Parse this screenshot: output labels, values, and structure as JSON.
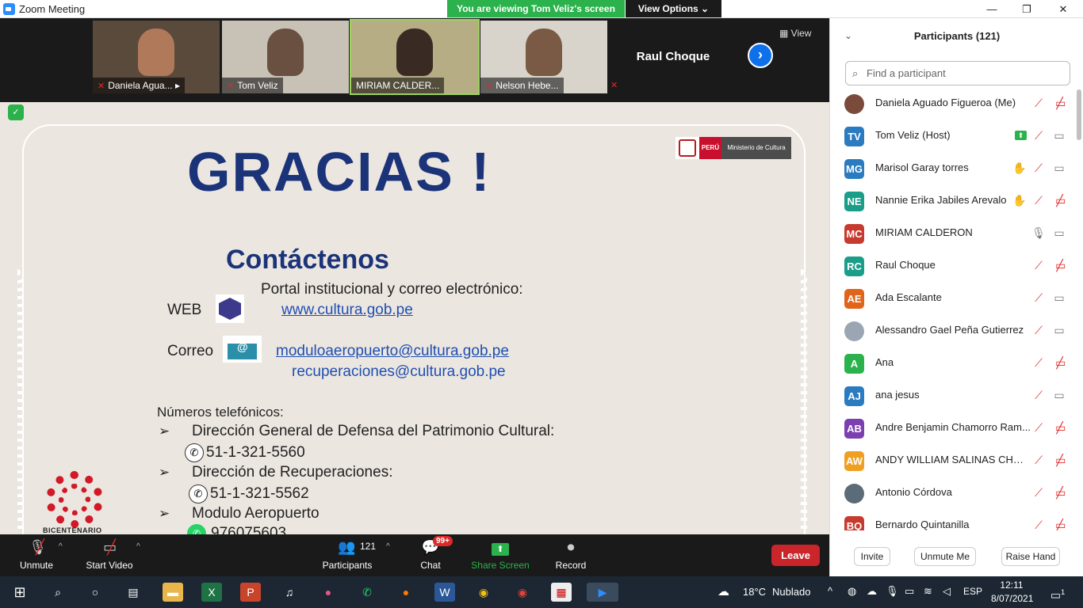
{
  "window": {
    "title": "Zoom Meeting",
    "viewing_banner": "You are viewing Tom Veliz's screen",
    "view_options": "View Options ⌄",
    "minimize": "—",
    "maximize": "❐",
    "close": "✕"
  },
  "gallery": {
    "thumbnails": [
      {
        "name": "Daniela Agua... ▸"
      },
      {
        "name": "Tom Veliz"
      },
      {
        "name": "MIRIAM CALDER..."
      },
      {
        "name": "Nelson Hebe..."
      },
      {
        "name": ""
      }
    ],
    "raul_tile": "Raul Choque",
    "next_arrow": "›",
    "view_label": "▦  View"
  },
  "slide": {
    "peru": "PERÚ",
    "ministerio": "Ministerio de Cultura",
    "gracias": "GRACIAS !",
    "contactenos": "Contáctenos",
    "portal": "Portal institucional y correo electrónico:",
    "web_label": "WEB",
    "web_url": "www.cultura.gob.pe",
    "correo_label": "Correo",
    "email1": "moduloaeropuerto@cultura.gob.pe",
    "email2": "recuperaciones@cultura.gob.pe",
    "numeros": "Números telefónicos:",
    "bullet_glyph": "➢",
    "dir1": "Dirección General de Defensa del Patrimonio Cultural:",
    "phone1": "51-1-321-5560",
    "dir2": "Dirección de Recuperaciones:",
    "phone2": "51-1-321-5562",
    "dir3": "Modulo Aeropuerto",
    "phone3": "976075603",
    "bicentenario": "BICENTENARIO"
  },
  "toolbar": {
    "unmute": "Unmute",
    "start_video": "Start Video",
    "participants": "Participants",
    "participants_count": "121",
    "chat": "Chat",
    "chat_badge": "99+",
    "share_screen": "Share Screen",
    "record": "Record",
    "leave": "Leave"
  },
  "panel": {
    "title": "Participants (121)",
    "collapse": "⌄",
    "search_placeholder": "Find a participant",
    "participants": [
      {
        "name": "Daniela Aguado Figueroa (Me)",
        "initials": "",
        "color": "#7a4a3a",
        "photo": true,
        "mic": "muted",
        "cam": "off",
        "hand": false,
        "sharing": false
      },
      {
        "name": "Tom Veliz (Host)",
        "initials": "TV",
        "color": "#2a7bbf",
        "photo": false,
        "mic": "muted",
        "cam": "on",
        "hand": false,
        "sharing": true
      },
      {
        "name": "Marisol Garay torres",
        "initials": "MG",
        "color": "#2a7bbf",
        "photo": false,
        "mic": "muted",
        "cam": "on",
        "hand": true,
        "sharing": false
      },
      {
        "name": "Nannie Erika Jabiles Arevalo",
        "initials": "NE",
        "color": "#1a9e8a",
        "photo": false,
        "mic": "muted",
        "cam": "off",
        "hand": true,
        "sharing": false
      },
      {
        "name": "MIRIAM CALDERON",
        "initials": "MC",
        "color": "#c73a2e",
        "photo": false,
        "mic": "on",
        "cam": "on",
        "hand": false,
        "sharing": false
      },
      {
        "name": "Raul Choque",
        "initials": "RC",
        "color": "#1a9e8a",
        "photo": false,
        "mic": "muted",
        "cam": "off",
        "hand": false,
        "sharing": false
      },
      {
        "name": "Ada Escalante",
        "initials": "AE",
        "color": "#e0641a",
        "photo": false,
        "mic": "muted",
        "cam": "on",
        "hand": false,
        "sharing": false
      },
      {
        "name": "Alessandro Gael Peña Gutierrez",
        "initials": "",
        "color": "#9aa7b3",
        "photo": true,
        "mic": "muted",
        "cam": "on",
        "hand": false,
        "sharing": false
      },
      {
        "name": "Ana",
        "initials": "A",
        "color": "#2bb24c",
        "photo": false,
        "mic": "muted",
        "cam": "off",
        "hand": false,
        "sharing": false
      },
      {
        "name": "ana jesus",
        "initials": "AJ",
        "color": "#2a7bbf",
        "photo": false,
        "mic": "muted",
        "cam": "on",
        "hand": false,
        "sharing": false
      },
      {
        "name": "Andre Benjamin Chamorro Ram...",
        "initials": "AB",
        "color": "#7b3fb0",
        "photo": false,
        "mic": "muted",
        "cam": "off",
        "hand": false,
        "sharing": false
      },
      {
        "name": "ANDY WILLIAM SALINAS CHUM...",
        "initials": "AW",
        "color": "#f0a020",
        "photo": false,
        "mic": "muted",
        "cam": "off",
        "hand": false,
        "sharing": false
      },
      {
        "name": "Antonio Córdova",
        "initials": "",
        "color": "#5b6b78",
        "photo": true,
        "mic": "muted",
        "cam": "off",
        "hand": false,
        "sharing": false
      },
      {
        "name": "Bernardo Quintanilla",
        "initials": "BQ",
        "color": "#c73a2e",
        "photo": false,
        "mic": "muted",
        "cam": "off",
        "hand": false,
        "sharing": false
      }
    ],
    "invite": "Invite",
    "unmute_me": "Unmute Me",
    "raise_hand": "Raise Hand"
  },
  "taskbar": {
    "weather_temp": "18°C",
    "weather_text": "Nublado",
    "language": "ESP",
    "time": "12:11",
    "date": "8/07/2021",
    "notifications": "1"
  },
  "icons": {
    "mic_muted": "🎙",
    "video_off": "📹",
    "participants": "👥",
    "chat": "💬",
    "share": "⬆",
    "record": "⏺",
    "search": "⌕",
    "hand": "✋",
    "mic": "🎙",
    "cam": "📷",
    "phone": "✆"
  }
}
